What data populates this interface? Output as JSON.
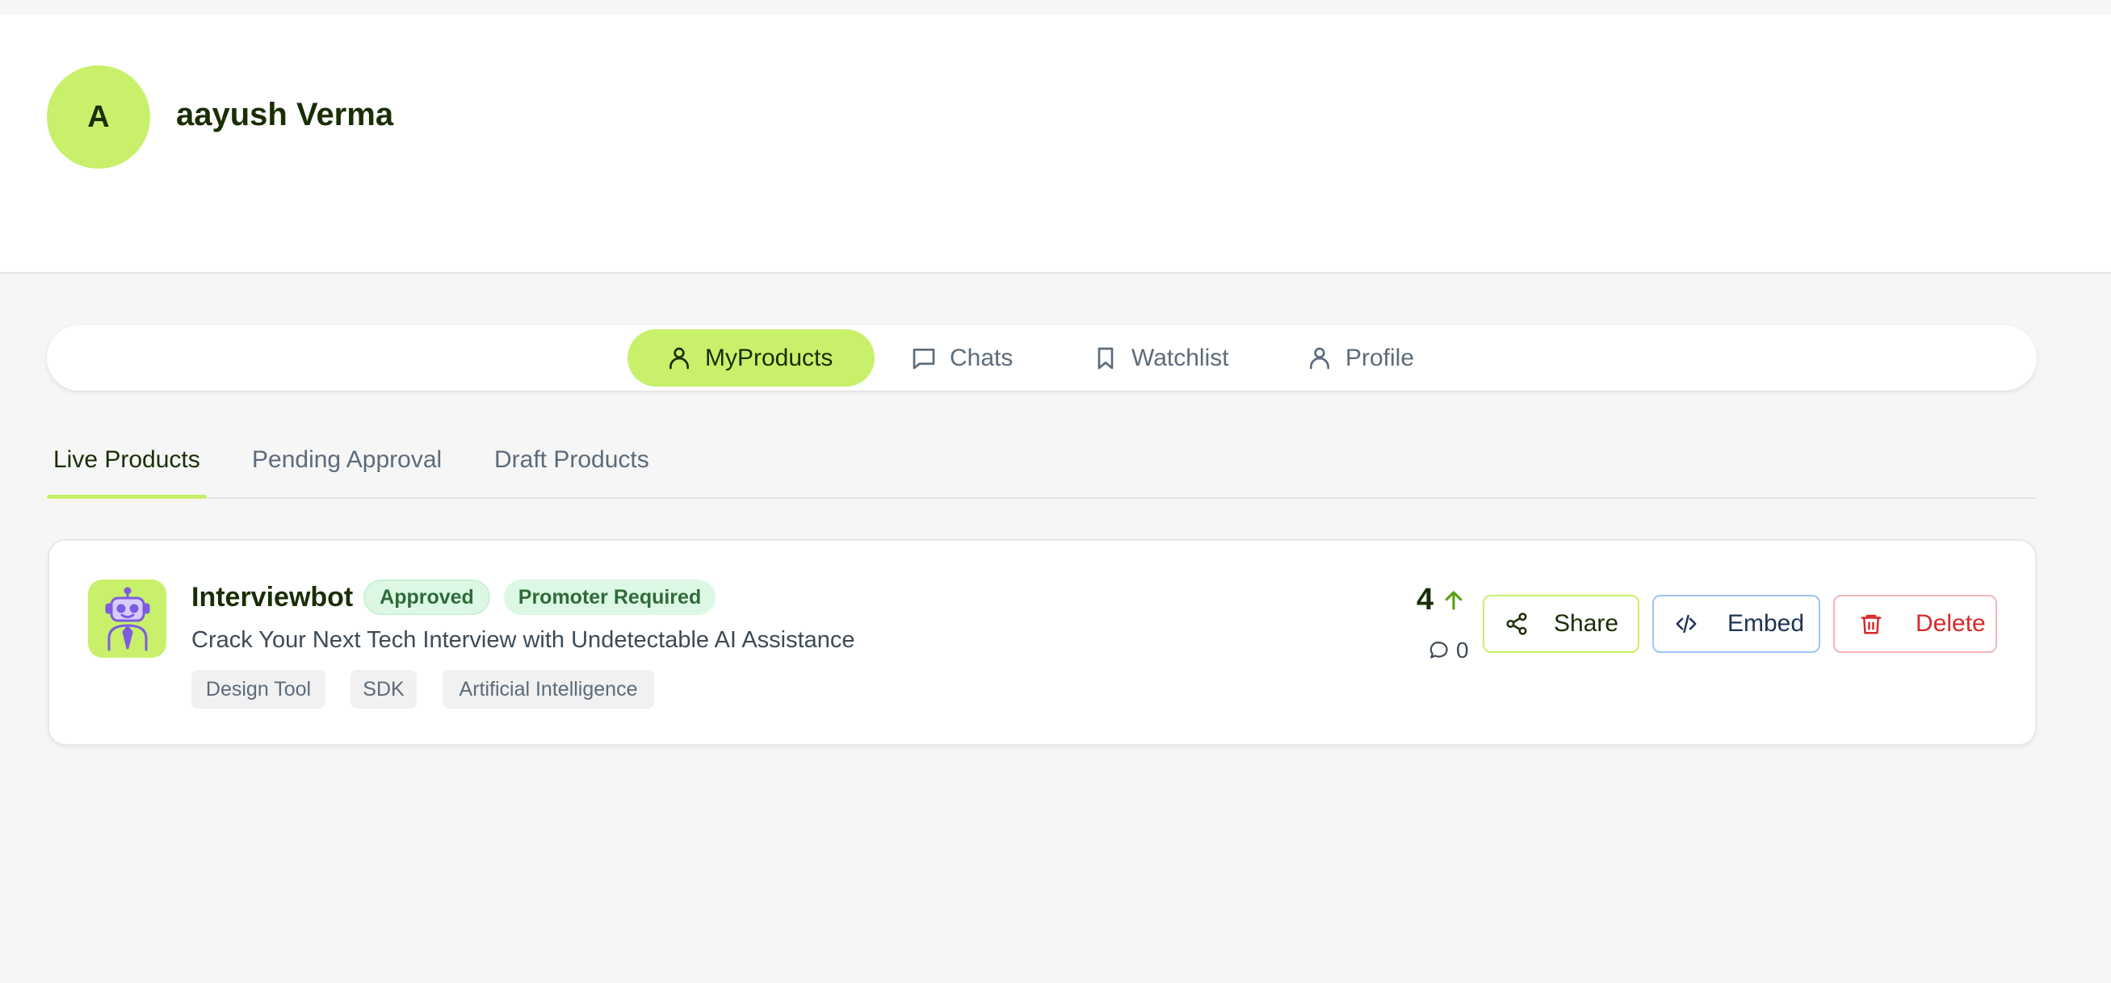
{
  "user": {
    "avatar_initial": "A",
    "name": "aayush Verma"
  },
  "nav": {
    "items": [
      {
        "label": "MyProducts",
        "icon": "user-icon",
        "active": true
      },
      {
        "label": "Chats",
        "icon": "chat-icon",
        "active": false
      },
      {
        "label": "Watchlist",
        "icon": "bookmark-icon",
        "active": false
      },
      {
        "label": "Profile",
        "icon": "user-icon",
        "active": false
      }
    ]
  },
  "subtabs": [
    {
      "label": "Live Products",
      "active": true
    },
    {
      "label": "Pending Approval",
      "active": false
    },
    {
      "label": "Draft Products",
      "active": false
    }
  ],
  "product": {
    "logo_icon": "robot-icon",
    "name": "Interviewbot",
    "badges": [
      "Approved",
      "Promoter Required"
    ],
    "description": "Crack Your Next Tech Interview with Undetectable AI Assistance",
    "tags": [
      "Design Tool",
      "SDK",
      "Artificial Intelligence"
    ],
    "upvotes": "4",
    "comments": "0",
    "actions": {
      "share": "Share",
      "embed": "Embed",
      "delete": "Delete"
    }
  },
  "colors": {
    "accent": "#c8f06b",
    "badge_bg": "#dcf8e4",
    "badge_text": "#2f6b3a",
    "embed_border": "#9ec5f5",
    "delete_red": "#d72929",
    "upvote_green": "#5aa014"
  }
}
